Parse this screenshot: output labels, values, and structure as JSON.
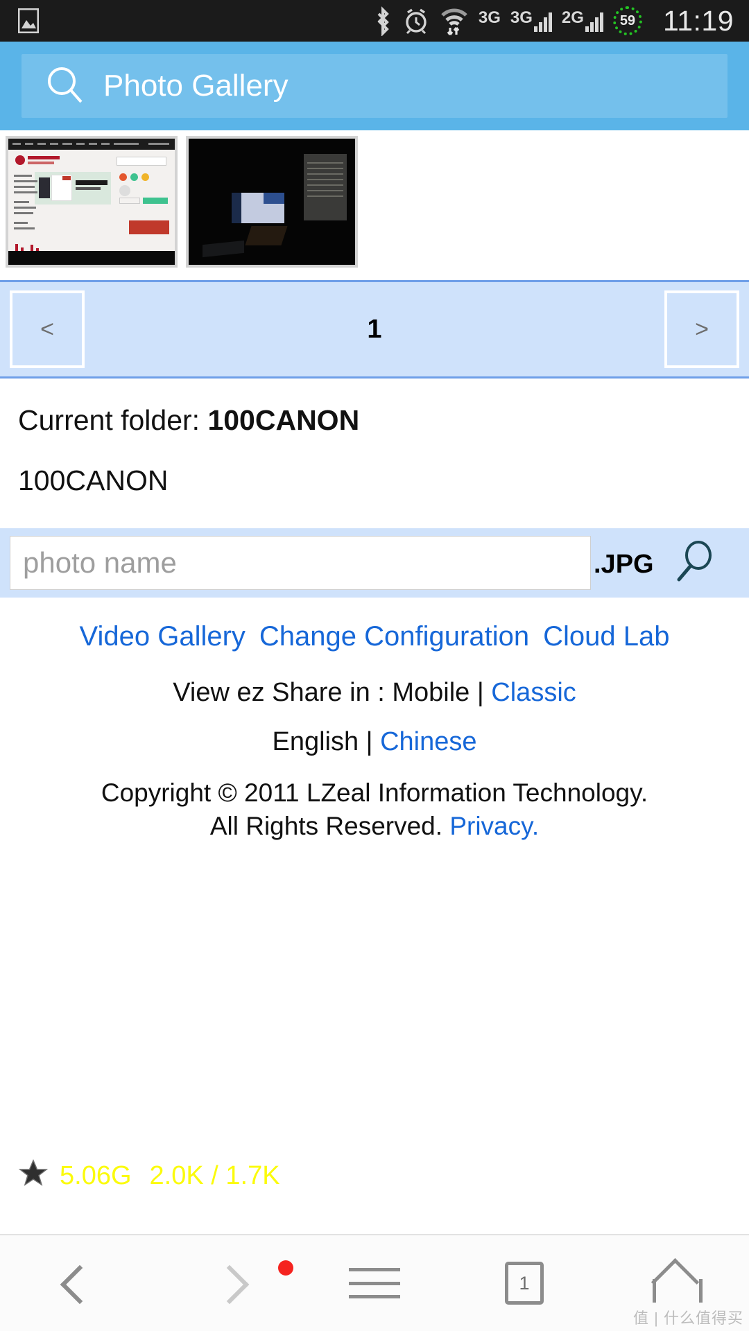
{
  "statusbar": {
    "time": "11:19",
    "battery_percent": "59",
    "network_labels": [
      "3G",
      "3G",
      "2G"
    ],
    "icons": [
      "image-icon",
      "bluetooth-icon",
      "alarm-icon",
      "wifi-icon"
    ]
  },
  "appbar": {
    "title": "Photo Gallery",
    "search_icon": "search-icon",
    "bg_color": "#5ab4e8",
    "box_color": "#74c0ec"
  },
  "thumbnails": [
    {
      "name": "photo-thumbnail-1",
      "alt": "screenshot of shopping web page"
    },
    {
      "name": "photo-thumbnail-2",
      "alt": "dark room with computer monitors"
    }
  ],
  "pager": {
    "prev_label": "<",
    "next_label": ">",
    "page": "1",
    "bg_color": "#cfe2fb",
    "border_color": "#6f9fe8"
  },
  "folder": {
    "current_label": "Current folder: ",
    "current_name": "100CANON",
    "listed_folder": "100CANON"
  },
  "photo_search": {
    "placeholder": "photo name",
    "value": "",
    "extension": ".JPG",
    "search_icon": "magnifier-icon"
  },
  "links": {
    "video_gallery": "Video Gallery",
    "change_configuration": "Change Configuration",
    "cloud_lab": "Cloud Lab"
  },
  "view_mode": {
    "prefix": "View ez Share in : Mobile | ",
    "classic": "Classic"
  },
  "language": {
    "current": "English | ",
    "other": "Chinese"
  },
  "copyright": {
    "line1": "Copyright © 2011 LZeal Information Technology.",
    "line2": "All Rights Reserved. ",
    "privacy": "Privacy."
  },
  "storage": {
    "star_icon": "star-icon",
    "capacity": "5.06G",
    "counts": "2.0K / 1.7K",
    "color": "#fbfb0c"
  },
  "navbar": {
    "back": "back-chevron-icon",
    "forward": "forward-chevron-icon",
    "menu": "hamburger-menu-icon",
    "tabs_count": "1",
    "home": "home-icon",
    "watermark": "值 | 什么值得买"
  }
}
